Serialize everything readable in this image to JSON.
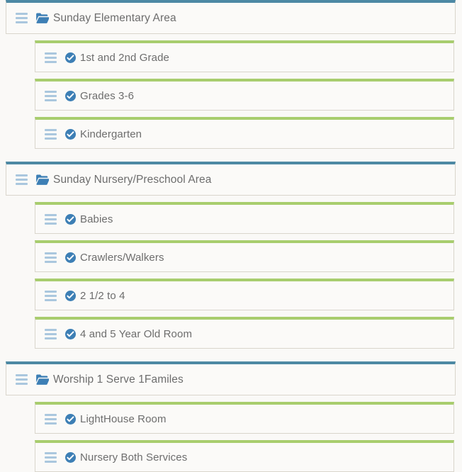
{
  "colors": {
    "page_background": "#faf9f7",
    "row_background": "#fbfaf8",
    "row_border": "#d9d5cc",
    "area_accent": "#4d89a4",
    "room_accent": "#a8cd6e",
    "handle": "#aac7de",
    "folder_icon": "#3d7fb5",
    "check_icon": "#3d7fb5",
    "label_text": "#6d6d6d"
  },
  "icons": {
    "drag_handle": "drag-handle-icon",
    "folder": "folder-open-icon",
    "check": "check-circle-icon"
  },
  "tree": {
    "groups": [
      {
        "area": {
          "label": "Sunday Elementary Area",
          "icon": "folder-open-icon"
        },
        "rooms": [
          {
            "label": "1st and 2nd Grade",
            "icon": "check-circle-icon"
          },
          {
            "label": "Grades 3-6",
            "icon": "check-circle-icon"
          },
          {
            "label": "Kindergarten",
            "icon": "check-circle-icon"
          }
        ]
      },
      {
        "area": {
          "label": "Sunday Nursery/Preschool Area",
          "icon": "folder-open-icon"
        },
        "rooms": [
          {
            "label": "Babies",
            "icon": "check-circle-icon"
          },
          {
            "label": "Crawlers/Walkers",
            "icon": "check-circle-icon"
          },
          {
            "label": "2 1/2 to 4",
            "icon": "check-circle-icon"
          },
          {
            "label": "4 and 5 Year Old Room",
            "icon": "check-circle-icon"
          }
        ]
      },
      {
        "area": {
          "label": "Worship 1 Serve 1Familes",
          "icon": "folder-open-icon"
        },
        "rooms": [
          {
            "label": "LightHouse Room",
            "icon": "check-circle-icon"
          },
          {
            "label": "Nursery Both Services",
            "icon": "check-circle-icon"
          }
        ]
      }
    ]
  }
}
